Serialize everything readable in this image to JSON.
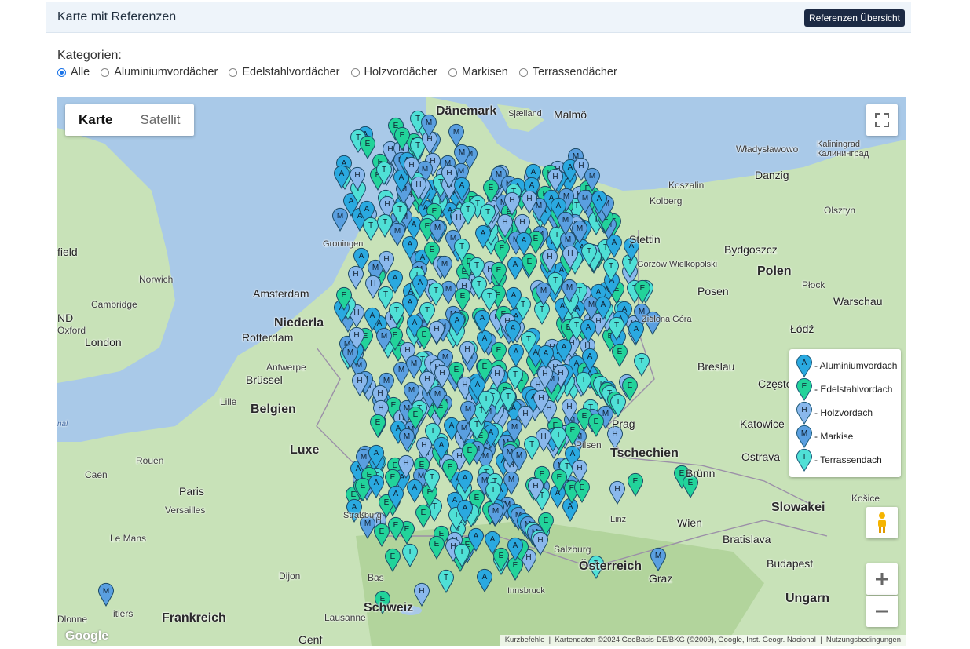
{
  "header": {
    "title": "Karte mit Referenzen",
    "overview_button": "Referenzen Übersicht"
  },
  "categories": {
    "label": "Kategorien:",
    "options": [
      "Alle",
      "Aluminiumvordächer",
      "Edelstahlvordächer",
      "Holzvordächer",
      "Markisen",
      "Terrassendächer"
    ],
    "selected": "Alle"
  },
  "map": {
    "type_active": "Karte",
    "type_inactive": "Satellit",
    "attribution": {
      "shortcuts": "Kurzbefehle",
      "data": "Kartendaten ©2024 GeoBasis-DE/BKG (©2009), Google, Inst. Geogr. Nacional",
      "terms": "Nutzungsbedingungen"
    },
    "logo": "Google",
    "places": [
      "Dänemark",
      "Sjælland",
      "Malmö",
      "Władysławowo",
      "Kaliningrad",
      "Калининград",
      "Koszalin",
      "Danzig",
      "Kolberg",
      "Olsztyn",
      "Stettin",
      "Bydgoszcz",
      "Gorzów Wielkopolski",
      "Polen",
      "Płock",
      "Posen",
      "Warschau",
      "Zielona Góra",
      "Łódź",
      "Breslau",
      "Często",
      "Groningen",
      "Amsterdam",
      "Niederla",
      "Rotterdam",
      "Antwerpe",
      "Brüssel",
      "Belgien",
      "Lille",
      "Luxe",
      "Caen",
      "Rouen",
      "Paris",
      "Versailles",
      "Le Mans",
      "Dijon",
      "Frankreich",
      "Lausanne",
      "Genf",
      "Dlonne",
      "itiers",
      "Straßburg",
      "Bas",
      "Schweiz",
      "Innsbruck",
      "Salzburg",
      "Österreich",
      "Linz",
      "Wien",
      "Graz",
      "Prag",
      "Tschechien",
      "Pilsen",
      "Brünn",
      "Katowice",
      "Ostrava",
      "Slowakei",
      "Košice",
      "Bratislava",
      "Budapest",
      "Ungarn",
      "Norwich",
      "Cambridge",
      "London",
      "Oxford",
      "field",
      "ND",
      "nal"
    ],
    "legend": [
      {
        "letter": "A",
        "label": "- Aluminiumvordach",
        "color": "#2aa9e0"
      },
      {
        "letter": "E",
        "label": "- Edelstahlvordach",
        "color": "#22d39a"
      },
      {
        "letter": "H",
        "label": "- Holzvordach",
        "color": "#8ab8ec"
      },
      {
        "letter": "M",
        "label": "- Markise",
        "color": "#5a9fe0"
      },
      {
        "letter": "T",
        "label": "- Terrassendach",
        "color": "#4fe0d6"
      }
    ]
  }
}
